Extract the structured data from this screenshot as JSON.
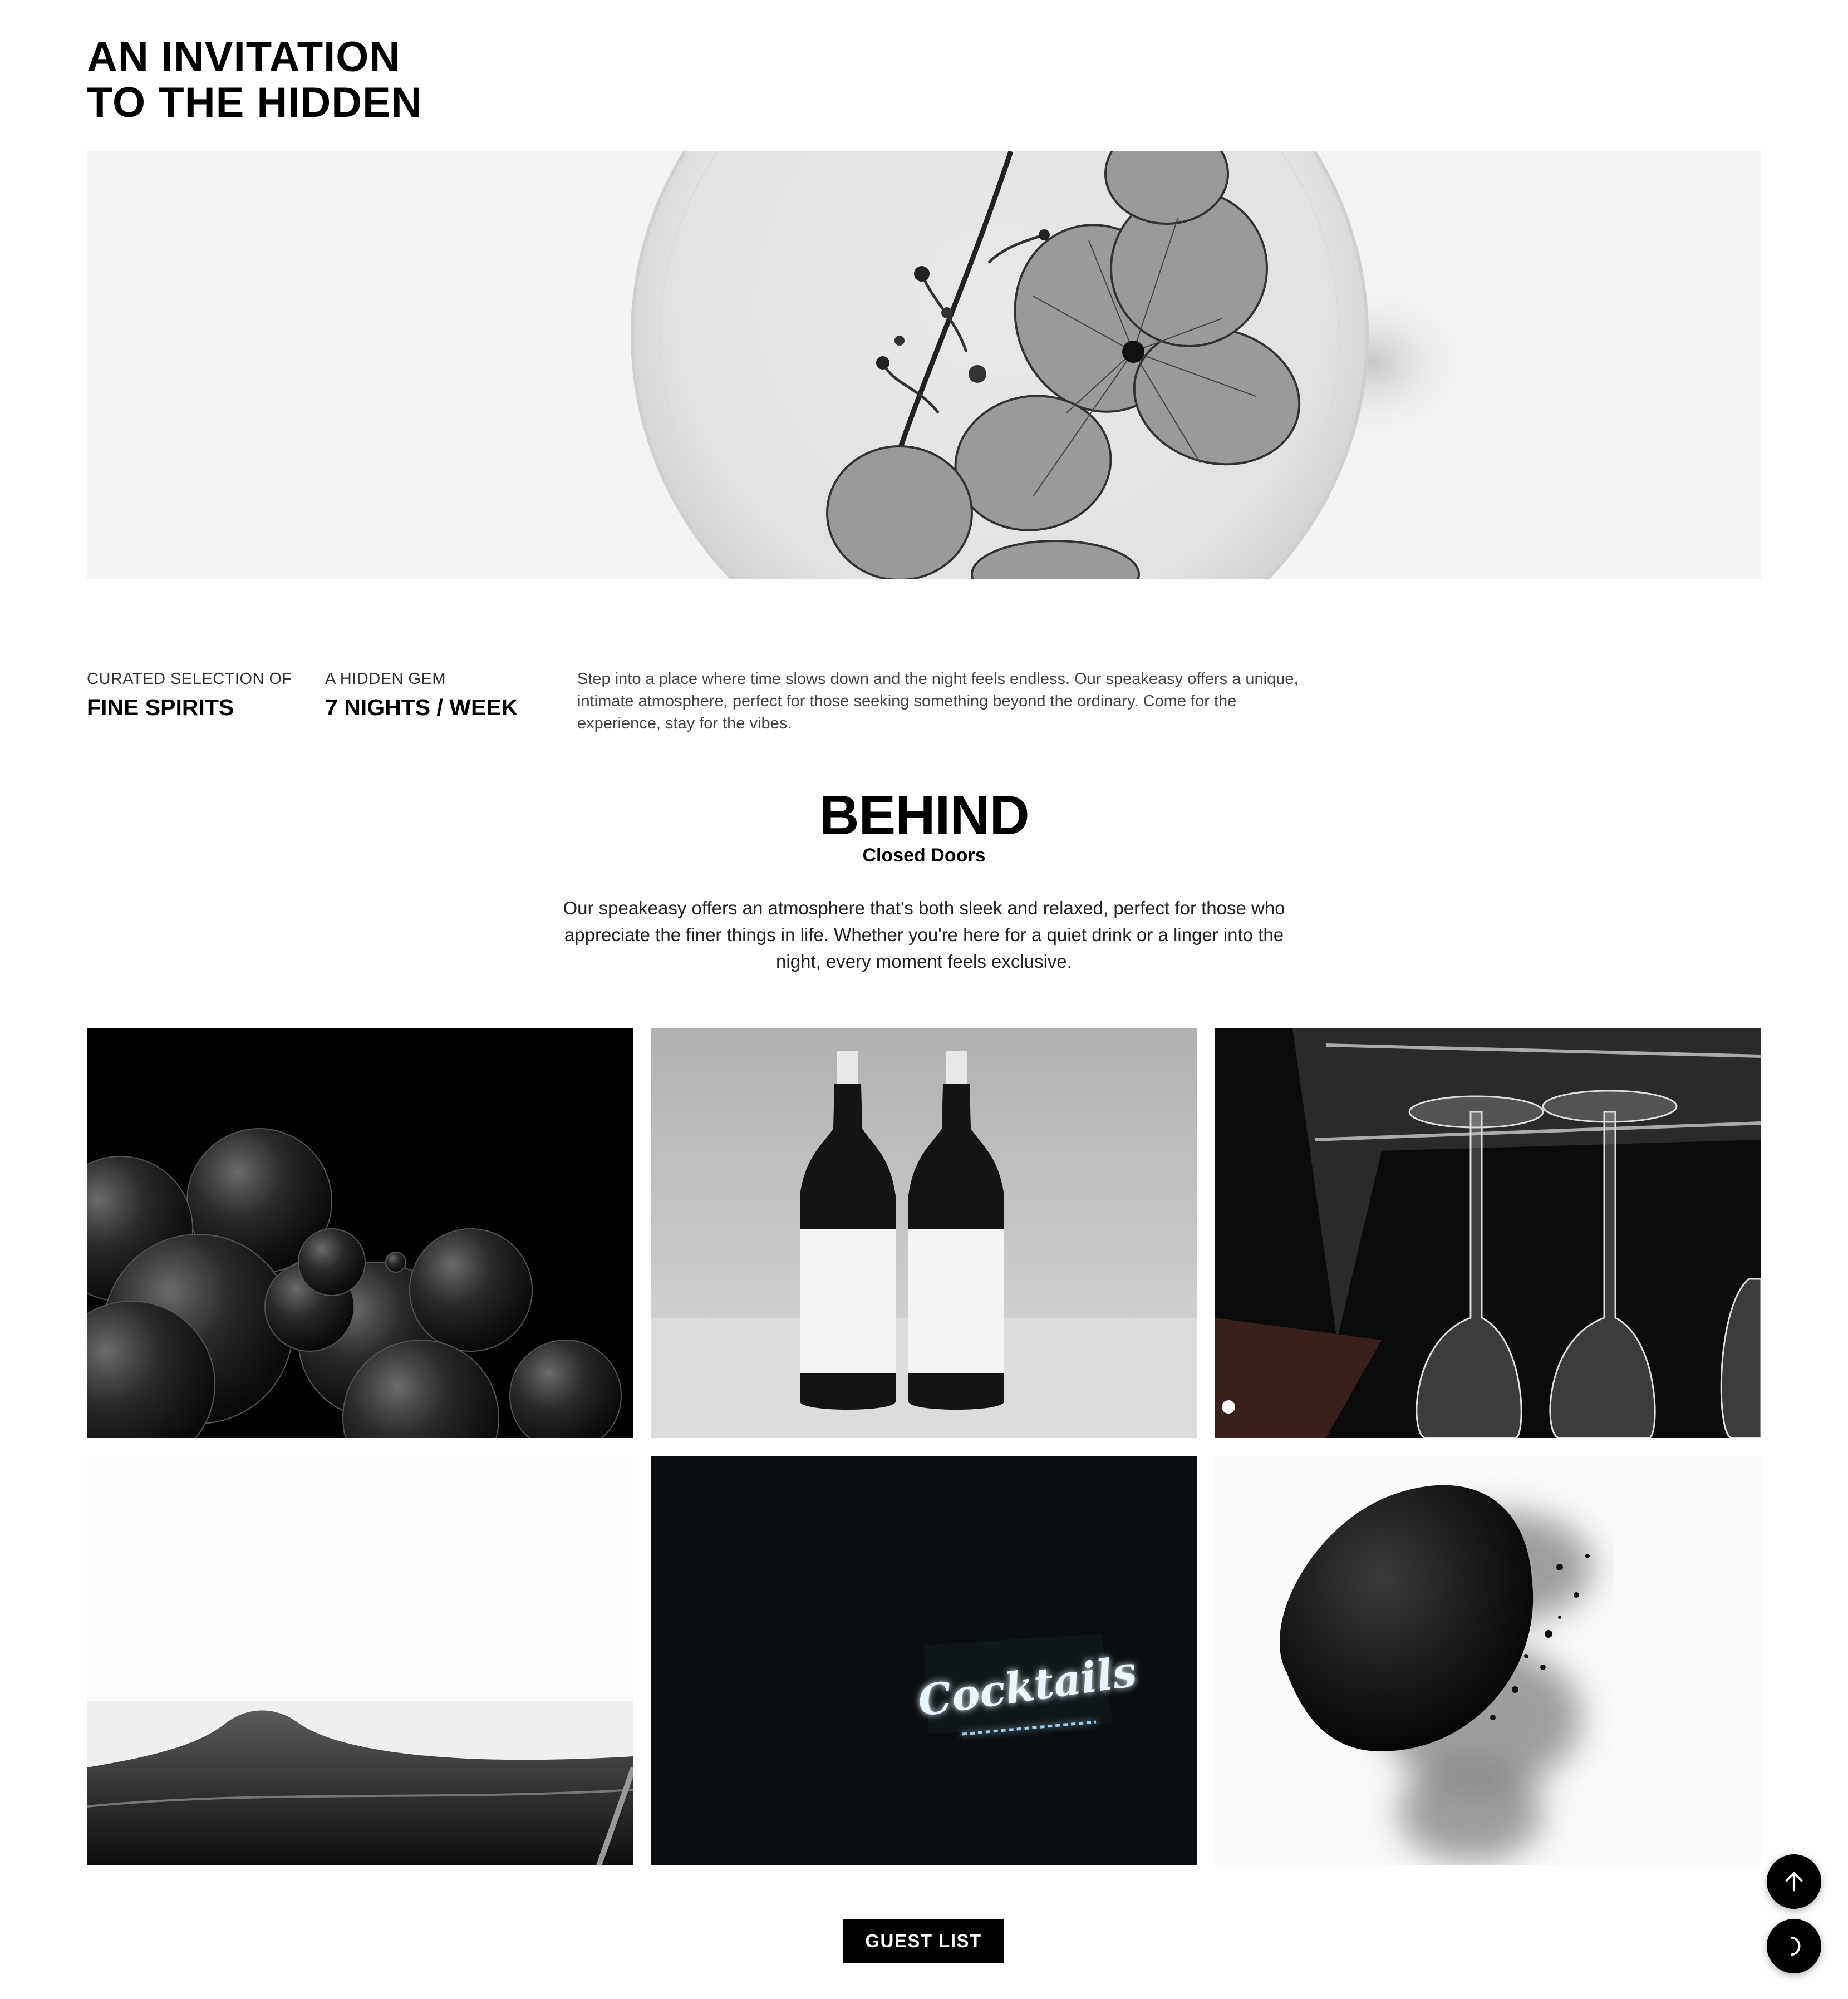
{
  "hero": {
    "title_line_1": "AN INVITATION",
    "title_line_2": "TO THE HIDDEN",
    "image": "pressed-flower-cocktail-image"
  },
  "stats": [
    {
      "eyebrow": "CURATED SELECTION OF",
      "value": "FINE SPIRITS"
    },
    {
      "eyebrow": "A HIDDEN GEM",
      "value": "7 NIGHTS / WEEK"
    }
  ],
  "intro": {
    "text": "Step into a place where time slows down and the night feels endless. Our speakeasy offers a unique, intimate atmosphere, perfect for those seeking something beyond the ordinary. Come for the experience, stay for the vibes."
  },
  "behind": {
    "title": "BEHIND",
    "subtitle": "Closed Doors",
    "text": "Our speakeasy offers an atmosphere that's both sleek and relaxed, perfect for those who appreciate the finer things in life. Whether you're here for a quiet drink or a linger into the night, every moment feels exclusive."
  },
  "gallery": {
    "images": [
      "bubbles-image",
      "wine-bottles-image",
      "hanging-glasses-image",
      "drink-foam-image",
      "cocktails-neon-image",
      "smoke-lemon-image"
    ],
    "neon_text": "Cocktails"
  },
  "cta": {
    "guest_list_label": "GUEST LIST"
  },
  "floating": {
    "scroll_top_icon": "arrow-up-icon",
    "theme_icon": "moon-icon"
  }
}
